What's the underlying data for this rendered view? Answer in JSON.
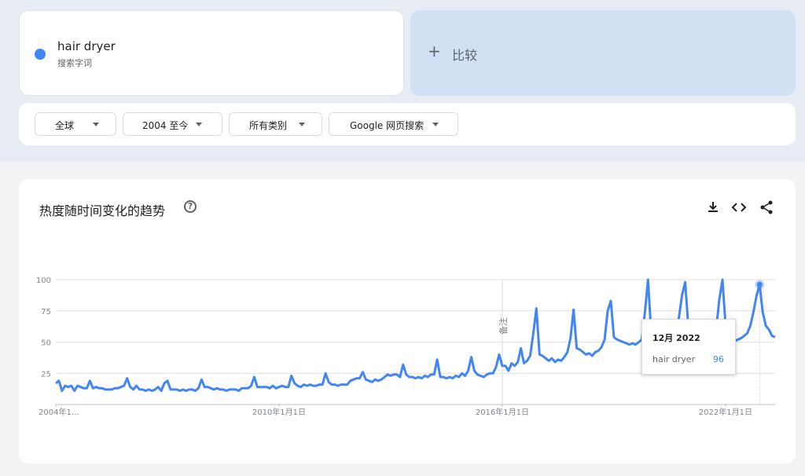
{
  "search_term": {
    "name": "hair dryer",
    "type": "搜索字词",
    "color": "#4285f4"
  },
  "compare": {
    "plus": "+",
    "label": "比较"
  },
  "filters": {
    "region": "全球",
    "period": "2004 至今",
    "category": "所有类别",
    "search_type": "Google 网页搜索"
  },
  "chart_section": {
    "title": "热度随时间变化的趋势",
    "help_icon": "help-circle-icon",
    "toolbar_icons": [
      "download-icon",
      "embed-code-icon",
      "share-icon"
    ]
  },
  "tooltip": {
    "date": "12月 2022",
    "term": "hair dryer",
    "value": "96"
  },
  "chart_data": {
    "type": "line",
    "title": "",
    "xlabel": "",
    "ylabel": "",
    "x_ticks": [
      "2004年1…",
      "2010年1月1日",
      "2016年1月1日",
      "2022年1月1日"
    ],
    "y_ticks": [
      25,
      50,
      75,
      100
    ],
    "ylim": [
      0,
      100
    ],
    "grid": true,
    "annotation": {
      "label": "备注",
      "x": "2016-01"
    },
    "highlight": {
      "x": "2022-12",
      "value": 96
    },
    "series": [
      {
        "name": "hair dryer",
        "color": "#4285f4",
        "start": "2004-01",
        "values": [
          17,
          19,
          11,
          15,
          14,
          15,
          11,
          15,
          14,
          13,
          13,
          19,
          13,
          14,
          13,
          13,
          12,
          12,
          12,
          13,
          13,
          14,
          15,
          21,
          14,
          12,
          15,
          12,
          12,
          11,
          12,
          11,
          12,
          14,
          11,
          17,
          19,
          12,
          12,
          12,
          11,
          12,
          11,
          12,
          12,
          11,
          13,
          20,
          14,
          14,
          13,
          12,
          13,
          12,
          12,
          11,
          12,
          12,
          12,
          11,
          13,
          13,
          13,
          15,
          22,
          14,
          14,
          14,
          14,
          13,
          15,
          13,
          14,
          15,
          14,
          14,
          23,
          17,
          15,
          14,
          16,
          15,
          16,
          15,
          15,
          16,
          16,
          25,
          18,
          16,
          16,
          15,
          16,
          16,
          16,
          19,
          20,
          21,
          21,
          26,
          20,
          19,
          18,
          20,
          19,
          20,
          22,
          24,
          23,
          24,
          24,
          22,
          32,
          24,
          22,
          22,
          21,
          22,
          21,
          23,
          22,
          24,
          24,
          36,
          22,
          22,
          21,
          22,
          21,
          23,
          22,
          25,
          23,
          27,
          38,
          27,
          24,
          23,
          22,
          24,
          25,
          25,
          30,
          40,
          31,
          31,
          27,
          33,
          31,
          34,
          45,
          33,
          35,
          39,
          57,
          77,
          40,
          39,
          37,
          35,
          37,
          34,
          36,
          35,
          38,
          42,
          53,
          76,
          45,
          44,
          42,
          40,
          41,
          39,
          42,
          43,
          46,
          52,
          75,
          83,
          54,
          52,
          51,
          50,
          49,
          48,
          49,
          48,
          50,
          52,
          74,
          100,
          59,
          50,
          49,
          47,
          48,
          48,
          50,
          53,
          60,
          70,
          88,
          98,
          62,
          54,
          51,
          49,
          51,
          50,
          52,
          51,
          55,
          61,
          84,
          100,
          64,
          56,
          54,
          51,
          52,
          53,
          55,
          57,
          63,
          74,
          87,
          96,
          74,
          63,
          60,
          55,
          54
        ]
      }
    ]
  }
}
